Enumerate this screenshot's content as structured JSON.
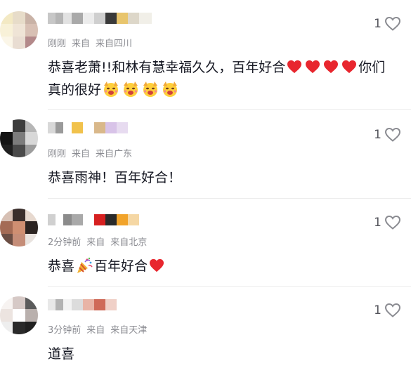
{
  "comments": [
    {
      "time": "刚刚",
      "from": "来自",
      "location": "来自四川",
      "text_parts": [
        "恭喜老萧!!和林有慧幸福久久，百年好合",
        "你们真的很好"
      ],
      "likes": "1",
      "avatar_colors": [
        "#f3e9c4",
        "#e7dcc9",
        "#c9b2a6",
        "#f8f1d8",
        "#efe4d6",
        "#d8c0b4",
        "#fbf6e8",
        "#e9ddd2",
        "#b3898a"
      ],
      "username_colors": [
        "#c7c7c7",
        "#b5b5b5",
        "#e2e2e2",
        "#a9a9a9",
        "#ececec",
        "#cfcfcf",
        "#3a3a3a",
        "#e8c56d",
        "#ddd7c9",
        "#f1efe8"
      ]
    },
    {
      "time": "刚刚",
      "from": "来自",
      "location": "来自广东",
      "text_parts": [
        "恭喜雨神！百年好合！"
      ],
      "likes": "1",
      "avatar_colors": [
        "#ffffff",
        "#3d3d3d",
        "#b6b6b6",
        "#141414",
        "#7c7c7c",
        "#d8d8d8",
        "#202020",
        "#4a4a4a",
        "#9d9d9d"
      ],
      "username_colors": [
        "#d8d8d8",
        "#9a9a9a",
        "#ffffff",
        "#f1c24c",
        "#ffffff",
        "#d9b88a",
        "#d8c3e8",
        "#e7dbf0"
      ]
    },
    {
      "time": "2分钟前",
      "from": "来自",
      "location": "来自北京",
      "text_parts": [
        "恭喜",
        "百年好合"
      ],
      "likes": "1",
      "avatar_colors": [
        "#d7c0b4",
        "#3b2f2c",
        "#e7d9cf",
        "#a46b55",
        "#cf8f72",
        "#2c2422",
        "#6b4e44",
        "#c58d78",
        "#e9e3df"
      ],
      "username_colors": [
        "#d0d0d0",
        "#ffffff",
        "#8b8b8b",
        "#a9a9a9",
        "#ffffff",
        "#d62020",
        "#2a2a2a",
        "#f1a32a",
        "#f5d7a4"
      ]
    },
    {
      "time": "3分钟前",
      "from": "来自",
      "location": "来自天津",
      "text_parts": [
        "道喜"
      ],
      "likes": "1",
      "avatar_colors": [
        "#f7f3f1",
        "#d6c9c6",
        "#5b5b5b",
        "#ece4e0",
        "#ffffff",
        "#b9b0ad",
        "#eeeeee",
        "#2a2a2a",
        "#202020"
      ],
      "username_colors": [
        "#e8e8e8",
        "#b3b3b3",
        "#f3f3f3",
        "#dcdcdc",
        "#e8b4a6",
        "#cf6a58",
        "#f0d0c7"
      ]
    }
  ],
  "colors": {
    "heart": "#e8262e",
    "meta": "#8a8b91",
    "like_outline": "#8a8b91"
  }
}
